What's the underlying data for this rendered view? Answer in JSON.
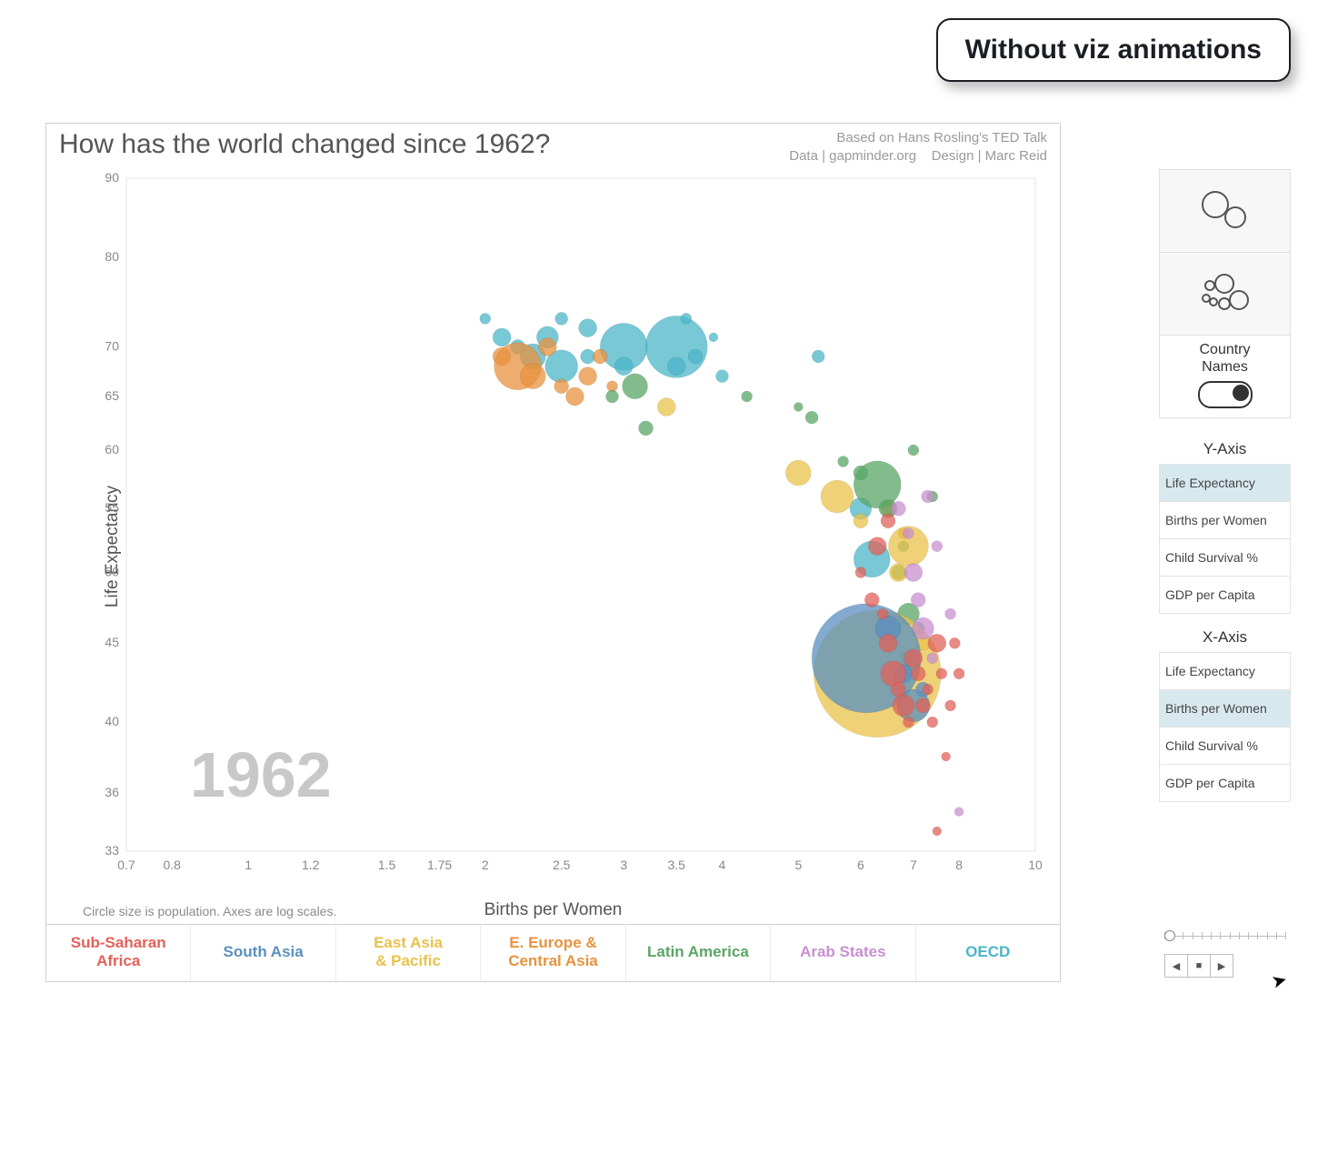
{
  "badge": "Without viz animations",
  "title": "How has the world changed since 1962?",
  "credits_line1": "Based on Hans Rosling's TED Talk",
  "credits_line2": "Data | gapminder.org    Design | Marc Reid",
  "y_axis_title": "Life Expectancy",
  "x_axis_title": "Births per Women",
  "caption": "Circle size is population.  Axes are log scales.",
  "year_watermark": "1962",
  "y_ticks": [
    "90",
    "80",
    "70",
    "65",
    "60",
    "55",
    "50",
    "45",
    "40",
    "36",
    "33"
  ],
  "x_ticks": [
    "0.7",
    "0.8",
    "1",
    "1.2",
    "1.5",
    "1.75",
    "2",
    "2.5",
    "3",
    "3.5",
    "4",
    "5",
    "6",
    "7",
    "8",
    "10"
  ],
  "country_names_label_1": "Country",
  "country_names_label_2": "Names",
  "country_names_on": true,
  "axis_controls": {
    "y_heading": "Y-Axis",
    "x_heading": "X-Axis",
    "options": [
      "Life Expectancy",
      "Births per Women",
      "Child Survival %",
      "GDP per Capita"
    ],
    "y_selected": 0,
    "x_selected": 1
  },
  "legend": [
    {
      "label": "Sub-Saharan Africa",
      "color": "#e2615a"
    },
    {
      "label": "South Asia",
      "color": "#5a8fbf"
    },
    {
      "label": "East Asia & Pacific",
      "color": "#e9c24b"
    },
    {
      "label": "E. Europe & Central Asia",
      "color": "#e8923e"
    },
    {
      "label": "Latin America",
      "color": "#5aa565"
    },
    {
      "label": "Arab States",
      "color": "#c98fd0"
    },
    {
      "label": "OECD",
      "color": "#4bb5c8"
    }
  ],
  "region_colors": {
    "ssa": "#e2615a",
    "sa": "#5a8fbf",
    "eap": "#e9c24b",
    "eeca": "#e8923e",
    "la": "#5aa565",
    "arab": "#c98fd0",
    "oecd": "#4bb5c8"
  },
  "playback": {
    "prev": "◀",
    "stop": "■",
    "play": "▶"
  },
  "chart_data": {
    "type": "scatter",
    "title": "How has the world changed since 1962?",
    "xlabel": "Births per Women",
    "ylabel": "Life Expectancy",
    "x_scale": "log",
    "y_scale": "log",
    "xlim": [
      0.7,
      10
    ],
    "ylim": [
      33,
      90
    ],
    "year": 1962,
    "size_encodes": "population",
    "legend_position": "bottom",
    "series": [
      {
        "name": "OECD",
        "color": "#4bb5c8",
        "points": [
          {
            "x": 2.0,
            "y": 73,
            "size": 6
          },
          {
            "x": 2.1,
            "y": 71,
            "size": 10
          },
          {
            "x": 2.2,
            "y": 70,
            "size": 8
          },
          {
            "x": 2.3,
            "y": 69,
            "size": 14
          },
          {
            "x": 2.4,
            "y": 71,
            "size": 12
          },
          {
            "x": 2.5,
            "y": 73,
            "size": 7
          },
          {
            "x": 2.5,
            "y": 68,
            "size": 18
          },
          {
            "x": 2.7,
            "y": 72,
            "size": 10
          },
          {
            "x": 2.7,
            "y": 69,
            "size": 8
          },
          {
            "x": 3.0,
            "y": 70,
            "size": 26
          },
          {
            "x": 3.0,
            "y": 68,
            "size": 10
          },
          {
            "x": 3.5,
            "y": 70,
            "size": 34
          },
          {
            "x": 3.5,
            "y": 68,
            "size": 10
          },
          {
            "x": 3.6,
            "y": 73,
            "size": 6
          },
          {
            "x": 3.7,
            "y": 69,
            "size": 8
          },
          {
            "x": 3.9,
            "y": 71,
            "size": 5
          },
          {
            "x": 4.0,
            "y": 67,
            "size": 7
          },
          {
            "x": 5.3,
            "y": 69,
            "size": 7
          },
          {
            "x": 6.0,
            "y": 55,
            "size": 12
          },
          {
            "x": 6.2,
            "y": 51,
            "size": 20
          }
        ]
      },
      {
        "name": "E. Europe & Central Asia",
        "color": "#e8923e",
        "points": [
          {
            "x": 2.1,
            "y": 69,
            "size": 10
          },
          {
            "x": 2.2,
            "y": 68,
            "size": 26
          },
          {
            "x": 2.3,
            "y": 67,
            "size": 14
          },
          {
            "x": 2.4,
            "y": 70,
            "size": 10
          },
          {
            "x": 2.5,
            "y": 66,
            "size": 8
          },
          {
            "x": 2.6,
            "y": 65,
            "size": 10
          },
          {
            "x": 2.7,
            "y": 67,
            "size": 10
          },
          {
            "x": 2.8,
            "y": 69,
            "size": 8
          },
          {
            "x": 2.9,
            "y": 66,
            "size": 6
          },
          {
            "x": 6.5,
            "y": 55,
            "size": 8
          },
          {
            "x": 6.8,
            "y": 53,
            "size": 6
          }
        ]
      },
      {
        "name": "Latin America",
        "color": "#5aa565",
        "points": [
          {
            "x": 2.9,
            "y": 65,
            "size": 7
          },
          {
            "x": 3.1,
            "y": 66,
            "size": 14
          },
          {
            "x": 3.2,
            "y": 62,
            "size": 8
          },
          {
            "x": 4.3,
            "y": 65,
            "size": 6
          },
          {
            "x": 5.0,
            "y": 64,
            "size": 5
          },
          {
            "x": 5.2,
            "y": 63,
            "size": 7
          },
          {
            "x": 5.7,
            "y": 59,
            "size": 6
          },
          {
            "x": 6.0,
            "y": 58,
            "size": 8
          },
          {
            "x": 6.3,
            "y": 57,
            "size": 26
          },
          {
            "x": 6.5,
            "y": 55,
            "size": 10
          },
          {
            "x": 6.7,
            "y": 50,
            "size": 8
          },
          {
            "x": 6.8,
            "y": 52,
            "size": 6
          },
          {
            "x": 6.9,
            "y": 47,
            "size": 12
          },
          {
            "x": 7.1,
            "y": 46,
            "size": 7
          },
          {
            "x": 7.4,
            "y": 56,
            "size": 6
          },
          {
            "x": 7.0,
            "y": 60,
            "size": 6
          },
          {
            "x": 6.9,
            "y": 44,
            "size": 8
          }
        ]
      },
      {
        "name": "East Asia & Pacific",
        "color": "#e9c24b",
        "points": [
          {
            "x": 3.4,
            "y": 64,
            "size": 10
          },
          {
            "x": 5.0,
            "y": 58,
            "size": 14
          },
          {
            "x": 5.6,
            "y": 56,
            "size": 18
          },
          {
            "x": 6.0,
            "y": 54,
            "size": 8
          },
          {
            "x": 6.3,
            "y": 43,
            "size": 70
          },
          {
            "x": 6.7,
            "y": 50,
            "size": 10
          },
          {
            "x": 6.9,
            "y": 52,
            "size": 22
          },
          {
            "x": 7.2,
            "y": 45,
            "size": 8
          }
        ]
      },
      {
        "name": "Arab States",
        "color": "#c98fd0",
        "points": [
          {
            "x": 6.7,
            "y": 55,
            "size": 8
          },
          {
            "x": 6.9,
            "y": 53,
            "size": 6
          },
          {
            "x": 7.0,
            "y": 50,
            "size": 10
          },
          {
            "x": 7.1,
            "y": 48,
            "size": 8
          },
          {
            "x": 7.2,
            "y": 46,
            "size": 12
          },
          {
            "x": 7.3,
            "y": 56,
            "size": 7
          },
          {
            "x": 7.4,
            "y": 44,
            "size": 6
          },
          {
            "x": 7.5,
            "y": 52,
            "size": 6
          },
          {
            "x": 7.8,
            "y": 47,
            "size": 6
          },
          {
            "x": 8.0,
            "y": 35,
            "size": 5
          }
        ]
      },
      {
        "name": "South Asia",
        "color": "#5a8fbf",
        "points": [
          {
            "x": 6.1,
            "y": 44,
            "size": 60
          },
          {
            "x": 6.5,
            "y": 46,
            "size": 14
          },
          {
            "x": 6.8,
            "y": 43,
            "size": 10
          },
          {
            "x": 7.0,
            "y": 41,
            "size": 18
          },
          {
            "x": 7.2,
            "y": 42,
            "size": 8
          }
        ]
      },
      {
        "name": "Sub-Saharan Africa",
        "color": "#e2615a",
        "points": [
          {
            "x": 6.0,
            "y": 50,
            "size": 6
          },
          {
            "x": 6.2,
            "y": 48,
            "size": 8
          },
          {
            "x": 6.4,
            "y": 47,
            "size": 6
          },
          {
            "x": 6.5,
            "y": 45,
            "size": 10
          },
          {
            "x": 6.6,
            "y": 43,
            "size": 14
          },
          {
            "x": 6.7,
            "y": 42,
            "size": 8
          },
          {
            "x": 6.8,
            "y": 41,
            "size": 12
          },
          {
            "x": 6.9,
            "y": 40,
            "size": 6
          },
          {
            "x": 7.0,
            "y": 44,
            "size": 10
          },
          {
            "x": 7.1,
            "y": 43,
            "size": 8
          },
          {
            "x": 7.2,
            "y": 41,
            "size": 8
          },
          {
            "x": 7.3,
            "y": 42,
            "size": 6
          },
          {
            "x": 7.4,
            "y": 40,
            "size": 6
          },
          {
            "x": 7.5,
            "y": 45,
            "size": 10
          },
          {
            "x": 7.6,
            "y": 43,
            "size": 6
          },
          {
            "x": 7.7,
            "y": 38,
            "size": 5
          },
          {
            "x": 7.8,
            "y": 41,
            "size": 6
          },
          {
            "x": 7.9,
            "y": 45,
            "size": 6
          },
          {
            "x": 8.0,
            "y": 43,
            "size": 6
          },
          {
            "x": 7.5,
            "y": 34,
            "size": 5
          },
          {
            "x": 6.3,
            "y": 52,
            "size": 10
          },
          {
            "x": 6.5,
            "y": 54,
            "size": 8
          }
        ]
      }
    ]
  }
}
